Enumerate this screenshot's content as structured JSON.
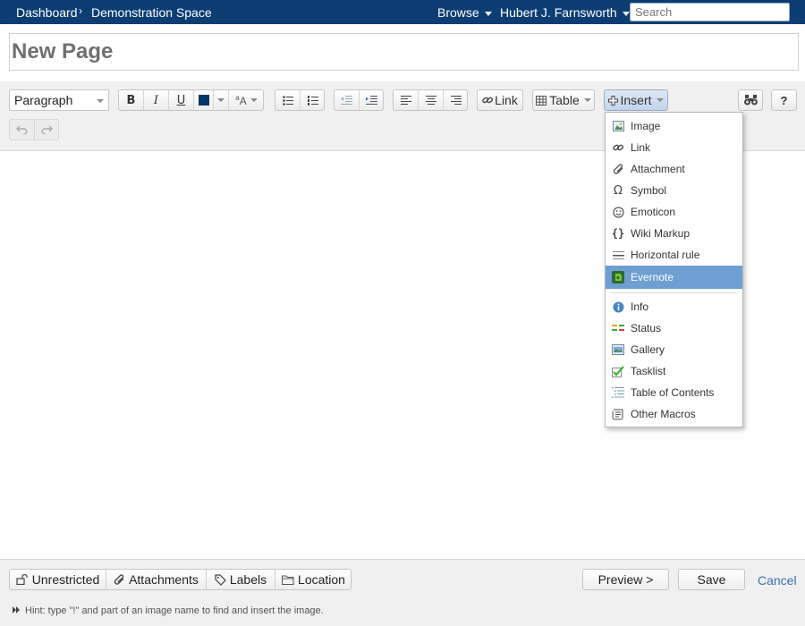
{
  "nav": {
    "dashboard": "Dashboard",
    "space": "Demonstration Space",
    "browse": "Browse",
    "user": "Hubert J. Farnsworth",
    "search_placeholder": "Search"
  },
  "page": {
    "title": "New Page"
  },
  "toolbar": {
    "format": "Paragraph",
    "bold": "B",
    "italic": "I",
    "underline": "U",
    "link": "Link",
    "table": "Table",
    "insert": "Insert",
    "help": "?",
    "text_color": "#003366"
  },
  "insert_menu": {
    "items": [
      {
        "label": "Image",
        "icon": "image-icon"
      },
      {
        "label": "Link",
        "icon": "link-icon"
      },
      {
        "label": "Attachment",
        "icon": "paperclip-icon"
      },
      {
        "label": "Symbol",
        "icon": "omega-icon"
      },
      {
        "label": "Emoticon",
        "icon": "smiley-icon"
      },
      {
        "label": "Wiki Markup",
        "icon": "braces-icon"
      },
      {
        "label": "Horizontal rule",
        "icon": "horizontal-rule-icon"
      },
      {
        "label": "Evernote",
        "icon": "evernote-icon"
      }
    ],
    "macros": [
      {
        "label": "Info",
        "icon": "info-icon"
      },
      {
        "label": "Status",
        "icon": "status-icon"
      },
      {
        "label": "Gallery",
        "icon": "gallery-icon"
      },
      {
        "label": "Tasklist",
        "icon": "checkmark-icon"
      },
      {
        "label": "Table of Contents",
        "icon": "toc-icon"
      },
      {
        "label": "Other Macros",
        "icon": "scroll-icon"
      }
    ],
    "highlight_color": "#6d9fd3"
  },
  "footer": {
    "restrictions": "Unrestricted",
    "attachments": "Attachments",
    "labels": "Labels",
    "location": "Location",
    "preview": "Preview >",
    "save": "Save",
    "cancel": "Cancel",
    "hint": "Hint: type \"!\" and part of an image name to find and insert the image."
  }
}
